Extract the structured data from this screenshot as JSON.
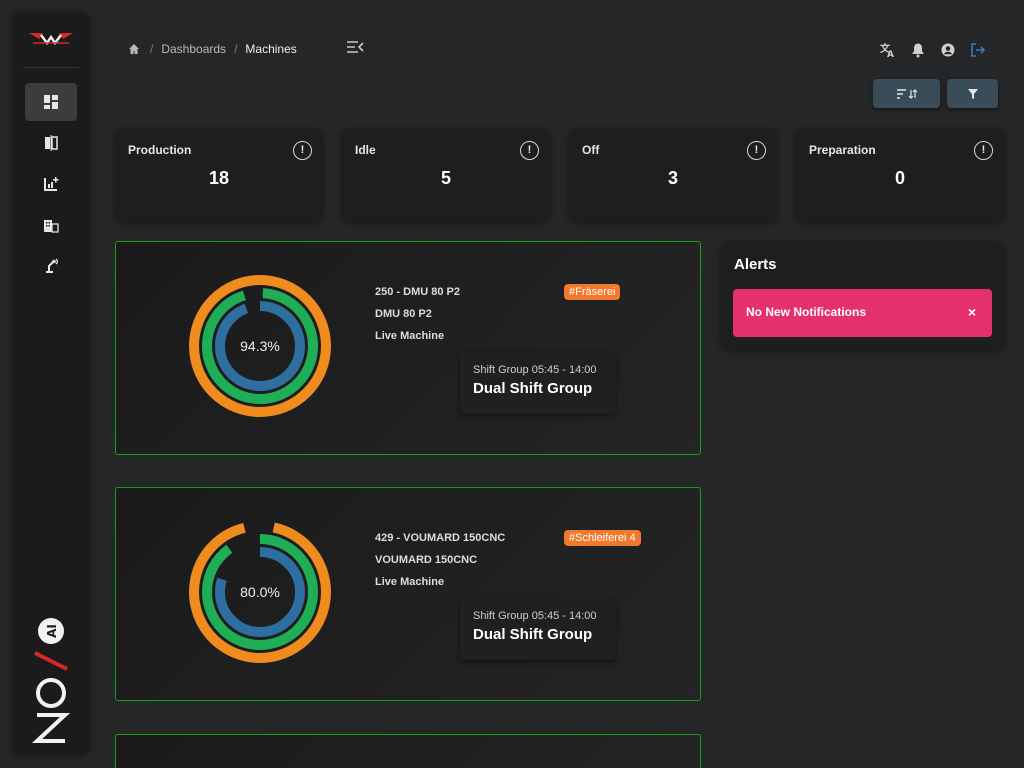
{
  "breadcrumb": {
    "items": [
      "Dashboards",
      "Machines"
    ]
  },
  "stats": [
    {
      "label": "Production",
      "value": "18",
      "info": "!"
    },
    {
      "label": "Idle",
      "value": "5",
      "info": "!"
    },
    {
      "label": "Off",
      "value": "3",
      "info": "!"
    },
    {
      "label": "Preparation",
      "value": "0",
      "info": "!"
    }
  ],
  "machines": [
    {
      "title": "250 - DMU 80 P2",
      "model": "DMU 80 P2",
      "status": "Live Machine",
      "tag": "#Fräserei",
      "percent": "94.3%",
      "percent_value": 94.3,
      "shift_label": "Shift Group 05:45 - 14:00",
      "shift_name": "Dual Shift Group"
    },
    {
      "title": "429 - VOUMARD 150CNC",
      "model": "VOUMARD 150CNC",
      "status": "Live Machine",
      "tag": "#Schleiferei 4",
      "percent": "80.0%",
      "percent_value": 80.0,
      "shift_label": "Shift Group 05:45 - 14:00",
      "shift_name": "Dual Shift Group"
    }
  ],
  "alerts": {
    "title": "Alerts",
    "message": "No New Notifications",
    "close": "×"
  },
  "colors": {
    "accent_orange": "#f08c1e",
    "accent_green": "#1fae55",
    "accent_blue": "#2f6f9f",
    "alert_pink": "#e5306f",
    "border_green": "#1a9e1a"
  }
}
